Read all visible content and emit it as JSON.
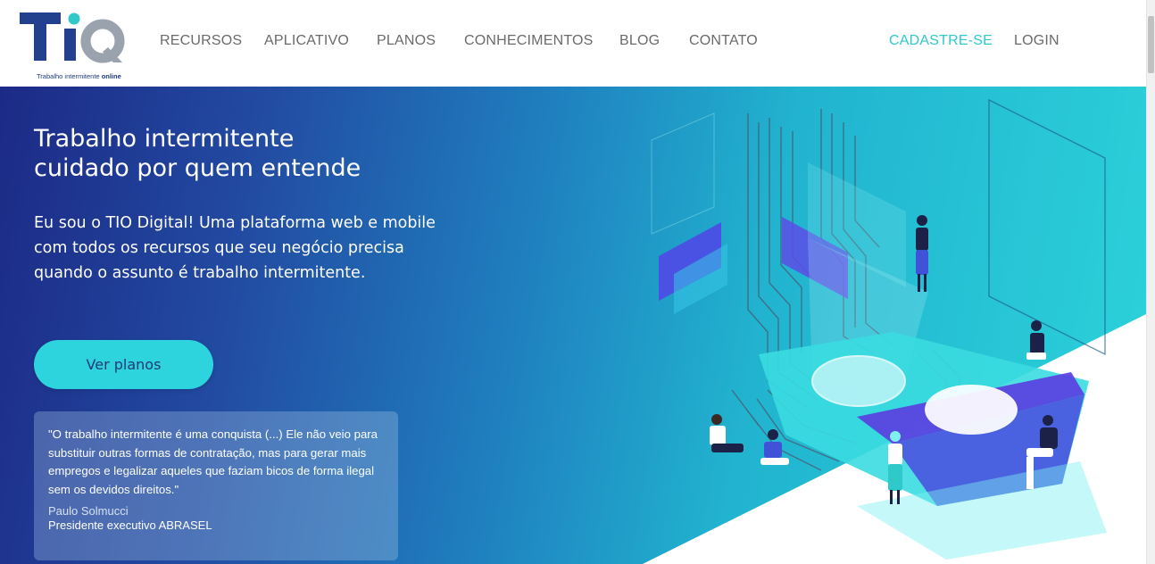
{
  "brand": {
    "logo_letters": "TIQ",
    "tagline_prefix": "Trabalho intermitente",
    "tagline_suffix": "online",
    "colors": {
      "navy": "#23408e",
      "gray": "#9aa3ad",
      "teal": "#2fc9c9"
    }
  },
  "nav": {
    "items": [
      "RECURSOS",
      "APLICATIVO",
      "PLANOS",
      "CONHECIMENTOS",
      "BLOG",
      "CONTATO"
    ],
    "signup": "CADASTRE-SE",
    "login": "LOGIN"
  },
  "hero": {
    "title_line1": "Trabalho intermitente",
    "title_line2": "cuidado por quem entende",
    "description": "Eu sou o TIO Digital! Uma plataforma web e mobile com todos os recursos que seu negócio precisa quando o assunto é trabalho intermitente.",
    "cta_label": "Ver planos",
    "illustration_icon": "workplace-illustration"
  },
  "quote": {
    "text": "\"O trabalho intermitente é uma conquista (...) Ele não veio para substituir outras formas de contratação, mas para gerar mais empregos e legalizar aqueles que faziam bicos de forma ilegal sem os devidos direitos.\"",
    "author": "Paulo Solmucci",
    "role": "Presidente executivo ABRASEL"
  }
}
